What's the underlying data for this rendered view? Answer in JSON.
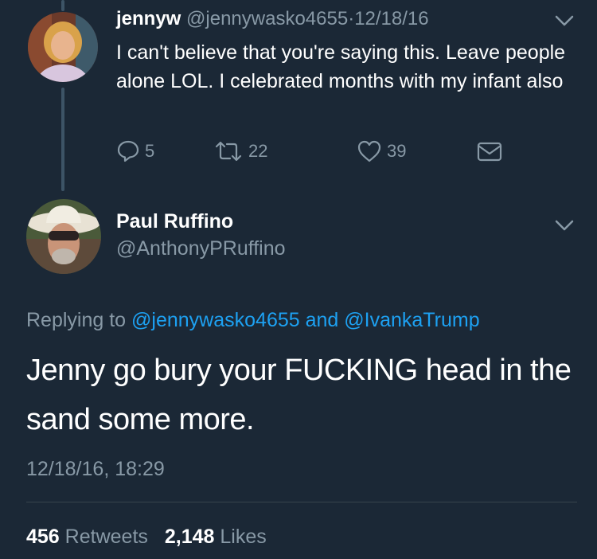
{
  "reply_tweet": {
    "display_name": "jennyw",
    "handle": "@jennywasko4655",
    "separator": "·",
    "date": "12/18/16",
    "text": "I can't believe that you're saying this. Leave people alone LOL. I celebrated months with my infant also",
    "reply_count": "5",
    "retweet_count": "22",
    "like_count": "39"
  },
  "main_tweet": {
    "display_name": "Paul Ruffino",
    "handle": "@AnthonyPRuffino",
    "replying_prefix": "Replying to",
    "replying_user1": "@jennywasko4655",
    "replying_and": "and",
    "replying_user2": "@IvankaTrump",
    "text": "Jenny go bury your FUCKING head in the sand some more.",
    "timestamp": "12/18/16, 18:29",
    "retweets_count": "456",
    "retweets_label": "Retweets",
    "likes_count": "2,148",
    "likes_label": "Likes"
  },
  "icons": {
    "reply": "reply-icon",
    "retweet": "retweet-icon",
    "like": "heart-icon",
    "dm": "envelope-icon",
    "menu": "chevron-down-icon"
  },
  "colors": {
    "background": "#1b2836",
    "muted": "#8899a6",
    "link": "#1da1f2",
    "text": "#ffffff"
  }
}
